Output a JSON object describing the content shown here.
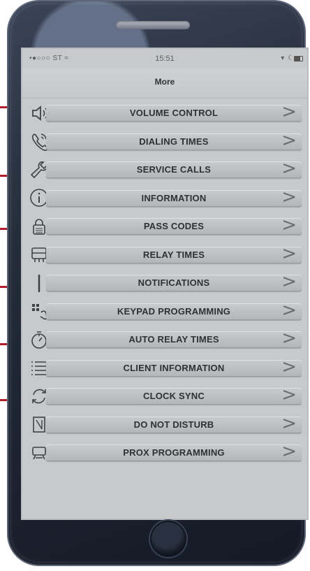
{
  "status": {
    "left_text": "•●○○○ ST ≈",
    "time": "15:51",
    "right_text": "▾ ☾"
  },
  "screen": {
    "title": "More"
  },
  "menu": {
    "items": [
      {
        "label": "VOLUME CONTROL",
        "icon": "speaker-icon"
      },
      {
        "label": "DIALING TIMES",
        "icon": "phone-icon"
      },
      {
        "label": "SERVICE CALLS",
        "icon": "wrench-icon"
      },
      {
        "label": "INFORMATION",
        "icon": "info-icon"
      },
      {
        "label": "PASS CODES",
        "icon": "lock-icon"
      },
      {
        "label": "RELAY TIMES",
        "icon": "relay-icon"
      },
      {
        "label": "NOTIFICATIONS",
        "icon": "notification-icon"
      },
      {
        "label": "KEYPAD PROGRAMMING",
        "icon": "keypad-icon"
      },
      {
        "label": "AUTO RELAY TIMES",
        "icon": "timer-icon"
      },
      {
        "label": "CLIENT INFORMATION",
        "icon": "list-icon"
      },
      {
        "label": "CLOCK SYNC",
        "icon": "sync-icon"
      },
      {
        "label": "DO NOT DISTURB",
        "icon": "do-not-disturb-icon"
      },
      {
        "label": "PROX PROGRAMMING",
        "icon": "prox-icon"
      }
    ],
    "chevron": ">"
  },
  "colors": {
    "screen_background": "#c7c9ca",
    "row_background": "#bdc0c1",
    "callout_line": "#b21d2b",
    "phone_frame": "#242b39"
  }
}
